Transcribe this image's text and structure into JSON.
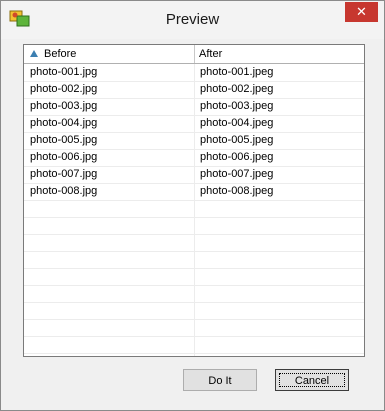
{
  "window": {
    "title": "Preview",
    "close_glyph": "✕"
  },
  "list": {
    "columns": [
      {
        "label": "Before",
        "sort": "ascending"
      },
      {
        "label": "After"
      }
    ],
    "rows": [
      {
        "before": "photo-001.jpg",
        "after": "photo-001.jpeg"
      },
      {
        "before": "photo-002.jpg",
        "after": "photo-002.jpeg"
      },
      {
        "before": "photo-003.jpg",
        "after": "photo-003.jpeg"
      },
      {
        "before": "photo-004.jpg",
        "after": "photo-004.jpeg"
      },
      {
        "before": "photo-005.jpg",
        "after": "photo-005.jpeg"
      },
      {
        "before": "photo-006.jpg",
        "after": "photo-006.jpeg"
      },
      {
        "before": "photo-007.jpg",
        "after": "photo-007.jpeg"
      },
      {
        "before": "photo-008.jpg",
        "after": "photo-008.jpeg"
      }
    ]
  },
  "buttons": {
    "do_it": "Do It",
    "cancel": "Cancel"
  },
  "colors": {
    "close_button": "#c7372f",
    "sort_arrow": "#3c7fb1"
  }
}
